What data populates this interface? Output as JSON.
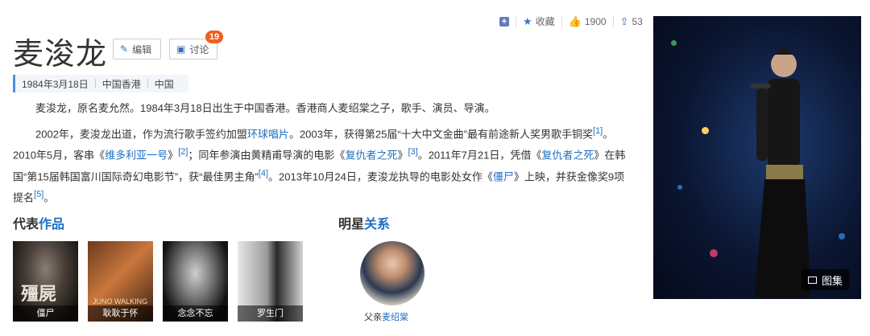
{
  "toolbar": {
    "favorite_label": "收藏",
    "like_count": "1900",
    "share_count": "53"
  },
  "title": "麦浚龙",
  "buttons": {
    "edit_label": "编辑",
    "discuss_label": "讨论",
    "discuss_badge": "19"
  },
  "meta": {
    "birth": "1984年3月18日",
    "birthplace": "中国香港",
    "country": "中国"
  },
  "para1": "麦浚龙，原名麦允然。1984年3月18日出生于中国香港。香港商人麦绍棠之子，歌手、演员、导演。",
  "para2": {
    "t1": "2002年，麦浚龙出道，作为流行歌手签约加盟",
    "l1": "环球唱片",
    "t2": "。2003年，获得第25届“十大中文金曲”最有前途新人奖男歌手铜奖",
    "r1": "[1]",
    "t3": "。2010年5月，客串《",
    "l2": "维多利亚一号",
    "t4": "》",
    "r2": "[2]",
    "t5": "；同年参演由黄精甫导演的电影《",
    "l3": "复仇者之死",
    "t6": "》",
    "r3": "[3]",
    "t7": "。2011年7月21日，凭借《",
    "l4": "复仇者之死",
    "t8": "》在韩国“第15届韩国富川国际奇幻电影节”，获“最佳男主角”",
    "r4": "[4]",
    "t9": "。2013年10月24日，麦浚龙执导的电影处女作《",
    "l5": "僵尸",
    "t10": "》上映，并获金像奖9项提名",
    "r5": "[5]",
    "t11": "。"
  },
  "works_section": {
    "prefix": "代表",
    "highlight": "作品"
  },
  "works": [
    {
      "title": "僵尸",
      "poster_text": "殭屍"
    },
    {
      "title": "耿耿于怀",
      "poster_text": "JUNO WALKING"
    },
    {
      "title": "念念不忘",
      "poster_text": ""
    },
    {
      "title": "罗生门",
      "poster_text": ""
    }
  ],
  "relation_section": {
    "prefix": "明星",
    "highlight": "关系"
  },
  "relation": {
    "role": "父亲",
    "name": "麦绍棠"
  },
  "gallery_label": "图集"
}
